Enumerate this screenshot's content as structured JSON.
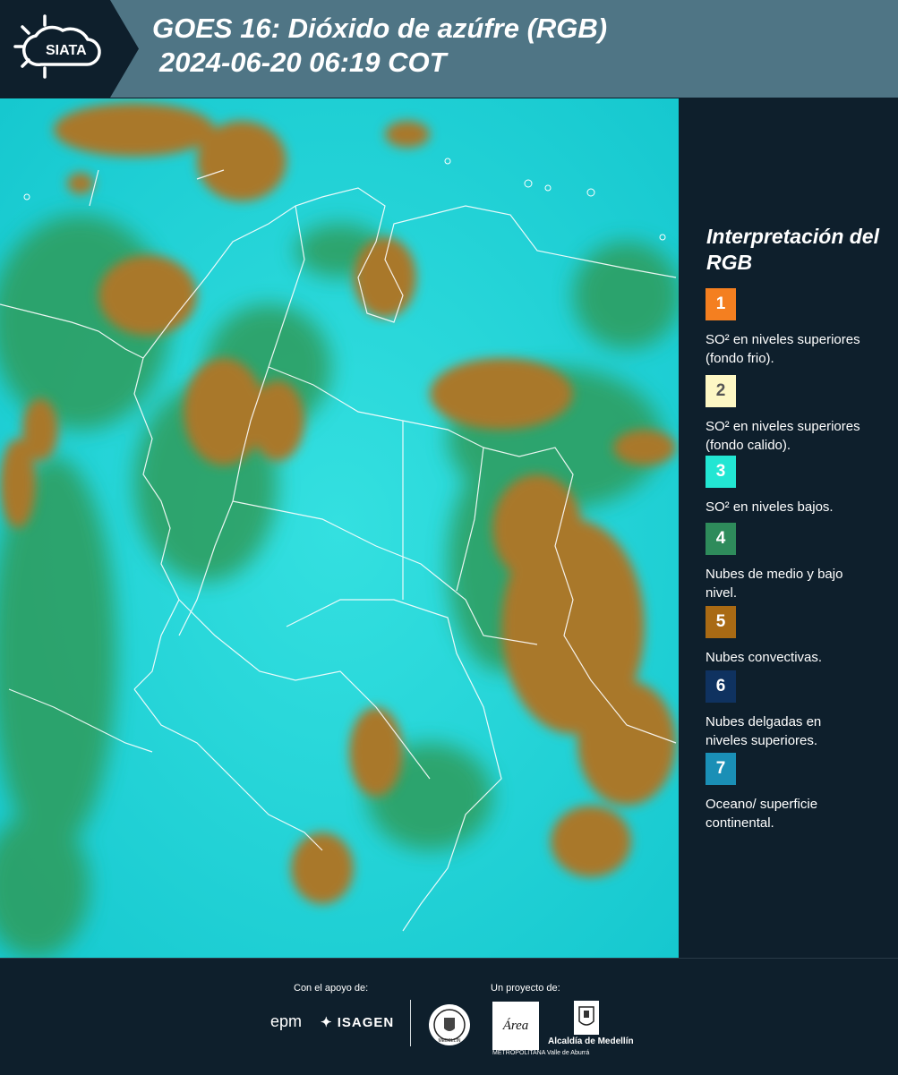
{
  "header": {
    "logo_text": "SIATA",
    "title_line1": "GOES 16: Dióxido de azúfre (RGB)",
    "title_line2": "2024-06-20 06:19 COT",
    "colors": {
      "bar": "#4f7585",
      "background": "#0e1f2c"
    }
  },
  "map": {
    "description_icon": "satellite-rgb-map",
    "colors": {
      "surface": "#1fd6d6",
      "mid_clouds": "#2e9a5c",
      "convective": "#a87a2c",
      "borders": "#ffffff"
    }
  },
  "legend": {
    "title": "Interpretación del RGB",
    "items": [
      {
        "number": "1",
        "text": "SO² en niveles superiores (fondo frio).",
        "color": "#f47f20",
        "text_color": "#ffffff"
      },
      {
        "number": "2",
        "text": "SO² en niveles superiores (fondo calido).",
        "color": "#fdf7c4",
        "text_color": "#555555"
      },
      {
        "number": "3",
        "text": "SO² en niveles bajos.",
        "color": "#22e6d3",
        "text_color": "#ffffff"
      },
      {
        "number": "4",
        "text": "Nubes de medio y bajo nivel.",
        "color": "#2e8b5b",
        "text_color": "#ffffff"
      },
      {
        "number": "5",
        "text": "Nubes convectivas.",
        "color": "#a96a14",
        "text_color": "#ffffff"
      },
      {
        "number": "6",
        "text": "Nubes delgadas en niveles superiores.",
        "color": "#0f3260",
        "text_color": "#ffffff"
      },
      {
        "number": "7",
        "text": "Oceano/ superficie continental.",
        "color": "#1a8fb6",
        "text_color": "#ffffff"
      }
    ]
  },
  "footer": {
    "support_label": "Con el apoyo de:",
    "project_label": "Un proyecto de:",
    "epm": "epm",
    "isagen": "ISAGEN",
    "area_text": "METROPOLITANA Valle de Aburrá",
    "area_logo_text": "Área",
    "medellin_seal_text": "MEDELLÍN",
    "alcaldia": "Alcaldía de Medellín"
  }
}
